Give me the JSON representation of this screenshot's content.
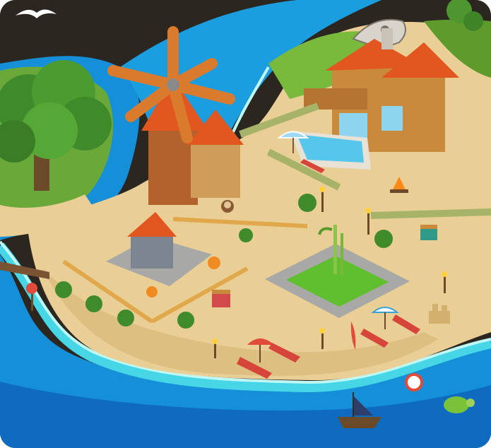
{
  "scene": {
    "name": "island-farm-map",
    "colors": {
      "dark_land": "#2b2620",
      "ocean_deep": "#0e6bc0",
      "ocean_mid": "#1a9ee0",
      "shallow": "#46d6e6",
      "foam": "#bff7f5",
      "sand": "#e9cf96",
      "sand_dark": "#d2b06e",
      "grass": "#79b93c",
      "roof": "#e2561f",
      "wood": "#c98a3e",
      "stone": "#a8a8a6",
      "pool": "#56c7ea"
    },
    "icons": [
      "seagull-icon",
      "tree-icon",
      "windmill-icon",
      "house-icon",
      "pool-icon",
      "stone-well-icon",
      "pumpkin-icon",
      "bamboo-plant-icon",
      "beach-chair-icon",
      "beach-umbrella-icon",
      "surfboard-icon",
      "sandcastle-icon",
      "beach-ball-icon",
      "turtle-icon",
      "pirate-ship-icon",
      "treasure-chest-icon",
      "monkey-icon",
      "campfire-icon",
      "torch-icon",
      "bridge-icon",
      "sign-icon",
      "dinosaur-skeleton-icon",
      "fence-icon",
      "bush-icon"
    ]
  }
}
